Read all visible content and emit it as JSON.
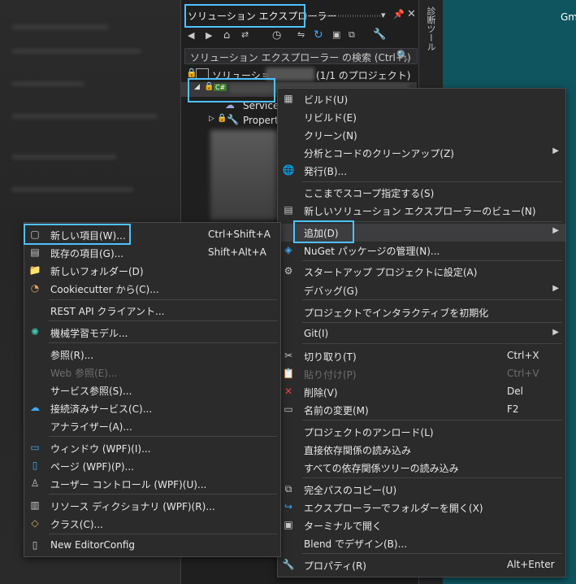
{
  "background": {
    "right_text": "Gm"
  },
  "solution_explorer": {
    "title": "ソリューション エクスプローラー",
    "search_placeholder": "ソリューション エクスプローラー の検索 (Ctrl+;)",
    "solution_label": "ソリューション",
    "solution_count": "(1/1 のプロジェクト)",
    "project_badge": "C#",
    "service_row": "Service R",
    "properties_row": "Properti",
    "vertical_tab": "診断ツール"
  },
  "main_menu": {
    "items": [
      {
        "label": "ビルド(U)",
        "icon": "build-icon"
      },
      {
        "label": "リビルド(E)"
      },
      {
        "label": "クリーン(N)"
      },
      {
        "label": "分析とコードのクリーンアップ(Z)",
        "submenu": true
      },
      {
        "label": "発行(B)...",
        "icon": "globe-icon"
      },
      {
        "label": "ここまでスコープ指定する(S)"
      },
      {
        "label": "新しいソリューション エクスプローラーのビュー(N)",
        "icon": "new-view-icon"
      },
      {
        "label": "追加(D)",
        "submenu": true
      },
      {
        "label": "NuGet パッケージの管理(N)...",
        "icon": "nuget-icon"
      },
      {
        "label": "スタートアップ プロジェクトに設定(A)",
        "icon": "gear-icon"
      },
      {
        "label": "デバッグ(G)",
        "submenu": true
      },
      {
        "label": "プロジェクトでインタラクティブを初期化"
      },
      {
        "label": "Git(I)",
        "submenu": true
      },
      {
        "label": "切り取り(T)",
        "shortcut": "Ctrl+X",
        "icon": "scissors-icon"
      },
      {
        "label": "貼り付け(P)",
        "shortcut": "Ctrl+V",
        "icon": "paste-icon",
        "disabled": true
      },
      {
        "label": "削除(V)",
        "shortcut": "Del",
        "icon": "delete-icon"
      },
      {
        "label": "名前の変更(M)",
        "shortcut": "F2",
        "icon": "rename-icon"
      },
      {
        "label": "プロジェクトのアンロード(L)"
      },
      {
        "label": "直接依存関係の読み込み"
      },
      {
        "label": "すべての依存関係ツリーの読み込み"
      },
      {
        "label": "完全パスのコピー(U)",
        "icon": "copy-icon"
      },
      {
        "label": "エクスプローラーでフォルダーを開く(X)",
        "icon": "open-folder-icon"
      },
      {
        "label": "ターミナルで開く",
        "icon": "terminal-icon"
      },
      {
        "label": "Blend でデザイン(B)..."
      },
      {
        "label": "プロパティ(R)",
        "shortcut": "Alt+Enter",
        "icon": "wrench-icon"
      }
    ]
  },
  "add_menu": {
    "items": [
      {
        "label": "新しい項目(W)...",
        "shortcut": "Ctrl+Shift+A",
        "icon": "new-item-icon"
      },
      {
        "label": "既存の項目(G)...",
        "shortcut": "Shift+Alt+A",
        "icon": "existing-item-icon"
      },
      {
        "label": "新しいフォルダー(D)",
        "icon": "folder-icon"
      },
      {
        "label": "Cookiecutter から(C)...",
        "icon": "cookie-icon"
      },
      {
        "label": "REST API クライアント..."
      },
      {
        "label": "機械学習モデル...",
        "icon": "ml-icon"
      },
      {
        "label": "参照(R)..."
      },
      {
        "label": "Web 参照(E)...",
        "disabled": true
      },
      {
        "label": "サービス参照(S)..."
      },
      {
        "label": "接続済みサービス(C)...",
        "icon": "connected-service-icon"
      },
      {
        "label": "アナライザー(A)..."
      },
      {
        "label": "ウィンドウ (WPF)(I)...",
        "icon": "window-icon"
      },
      {
        "label": "ページ (WPF)(P)...",
        "icon": "page-icon"
      },
      {
        "label": "ユーザー コントロール (WPF)(U)...",
        "icon": "user-control-icon"
      },
      {
        "label": "リソース ディクショナリ (WPF)(R)...",
        "icon": "resource-dict-icon"
      },
      {
        "label": "クラス(C)...",
        "icon": "class-icon"
      },
      {
        "label": "New EditorConfig",
        "icon": "editorconfig-icon"
      }
    ]
  }
}
